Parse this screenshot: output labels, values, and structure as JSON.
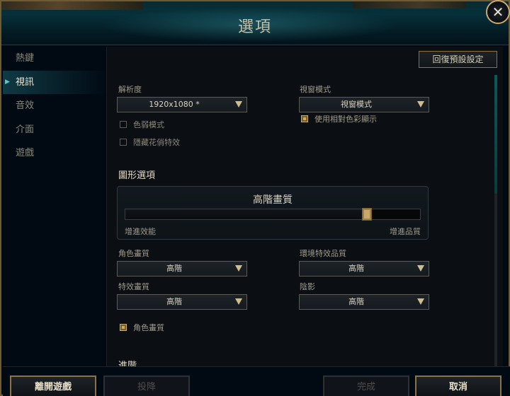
{
  "window": {
    "title": "選項"
  },
  "sidebar": {
    "items": [
      {
        "label": "熱鍵",
        "active": false
      },
      {
        "label": "視訊",
        "active": true
      },
      {
        "label": "音效",
        "active": false
      },
      {
        "label": "介面",
        "active": false
      },
      {
        "label": "遊戲",
        "active": false
      }
    ]
  },
  "content": {
    "reset_button": "回復預設設定",
    "resolution": {
      "label": "解析度",
      "value": "1920x1080 *"
    },
    "window_mode": {
      "label": "視窗模式",
      "value": "視窗模式"
    },
    "checkboxes_left": [
      {
        "label": "色弱模式",
        "checked": false
      },
      {
        "label": "隱藏花俏特效",
        "checked": false
      }
    ],
    "relative_color": {
      "label": "使用相對色彩顯示",
      "checked": true
    },
    "graphics_section": "圖形選項",
    "quality": {
      "title": "高階畫質",
      "low_label": "增進效能",
      "high_label": "增進品質",
      "level": 0.82
    },
    "character_quality": {
      "label": "角色畫質",
      "value": "高階"
    },
    "environment_quality": {
      "label": "環境特效品質",
      "value": "高階"
    },
    "effects_quality": {
      "label": "特效畫質",
      "value": "高階"
    },
    "shadows": {
      "label": "陰影",
      "value": "高階"
    },
    "character_inking": {
      "label": "角色畫質",
      "checked": true
    },
    "advanced_section": "進階"
  },
  "footer": {
    "exit_game": "離開遊戲",
    "surrender": "投降",
    "done": "完成",
    "cancel": "取消"
  },
  "colors": {
    "gold": "#c8aa6e",
    "teal": "#0a5a5a",
    "background": "#010a13"
  },
  "icons": {
    "close": "close-icon",
    "nav_active": "chevron-right-icon"
  }
}
